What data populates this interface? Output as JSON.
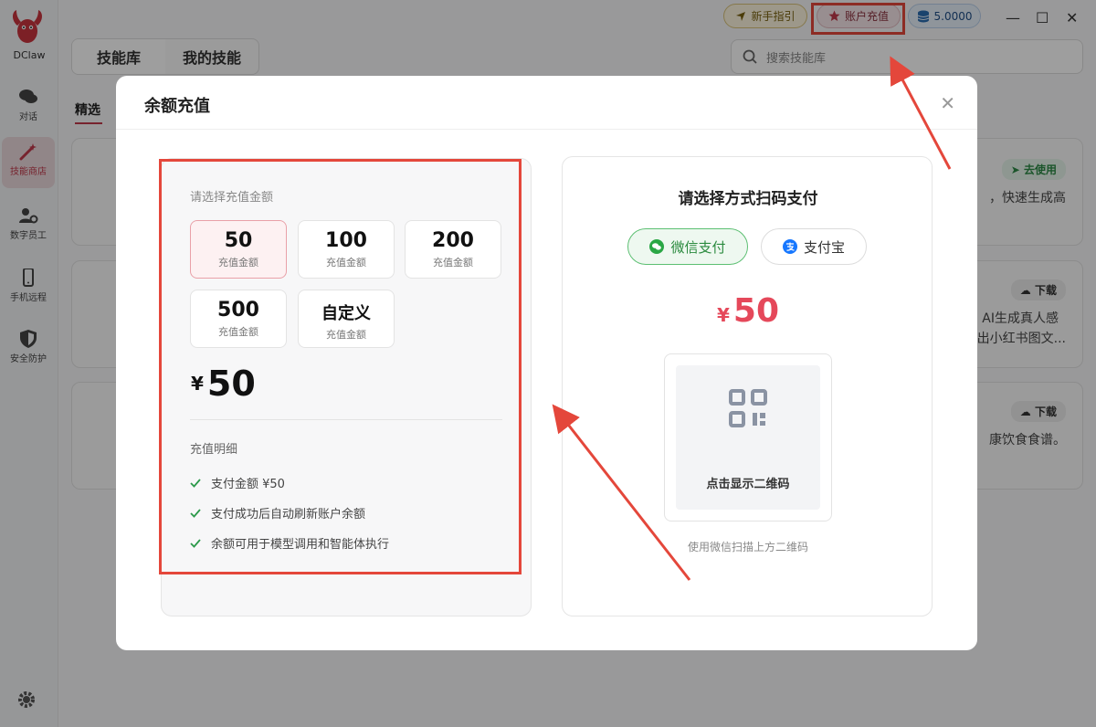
{
  "app": {
    "name": "DClaw"
  },
  "sidebar": {
    "items": [
      {
        "label": "对话",
        "icon": "chat-icon"
      },
      {
        "label": "技能商店",
        "icon": "magic-wand-icon",
        "active": true
      },
      {
        "label": "数字员工",
        "icon": "user-gear-icon"
      },
      {
        "label": "手机远程",
        "icon": "phone-icon"
      },
      {
        "label": "安全防护",
        "icon": "shield-icon"
      }
    ],
    "settings_icon": "gear-icon"
  },
  "header": {
    "guide_label": "新手指引",
    "recharge_label": "账户充值",
    "balance": "5.0000",
    "tabs": [
      "技能库",
      "我的技能"
    ],
    "search_placeholder": "搜索技能库",
    "subtab": "精选"
  },
  "background": {
    "cards": [
      {
        "badge": "去使用",
        "text": "，快速生成高"
      },
      {
        "badge": "下载",
        "text1": "AI生成真人感",
        "text2": "出小红书图文..."
      },
      {
        "badge": "下载",
        "text": "康饮食食谱。"
      }
    ]
  },
  "modal": {
    "title": "余额充值",
    "select_label": "请选择充值金额",
    "amounts": [
      {
        "value": "50",
        "sub": "充值金额",
        "selected": true
      },
      {
        "value": "100",
        "sub": "充值金额"
      },
      {
        "value": "200",
        "sub": "充值金额"
      },
      {
        "value": "500",
        "sub": "充值金额"
      },
      {
        "value": "自定义",
        "sub": "充值金额"
      }
    ],
    "currency": "¥",
    "selected_amount": "50",
    "detail_title": "充值明细",
    "details": [
      "支付金额 ¥50",
      "支付成功后自动刷新账户余额",
      "余额可用于模型调用和智能体执行"
    ],
    "pay_title": "请选择方式扫码支付",
    "pay_methods": [
      "微信支付",
      "支付宝"
    ],
    "qr_hint": "点击显示二维码",
    "scan_hint": "使用微信扫描上方二维码"
  },
  "colors": {
    "accent": "#c0394b",
    "price": "#e5485a",
    "wechat": "#2a8a3e",
    "annotation": "#e4473b"
  }
}
